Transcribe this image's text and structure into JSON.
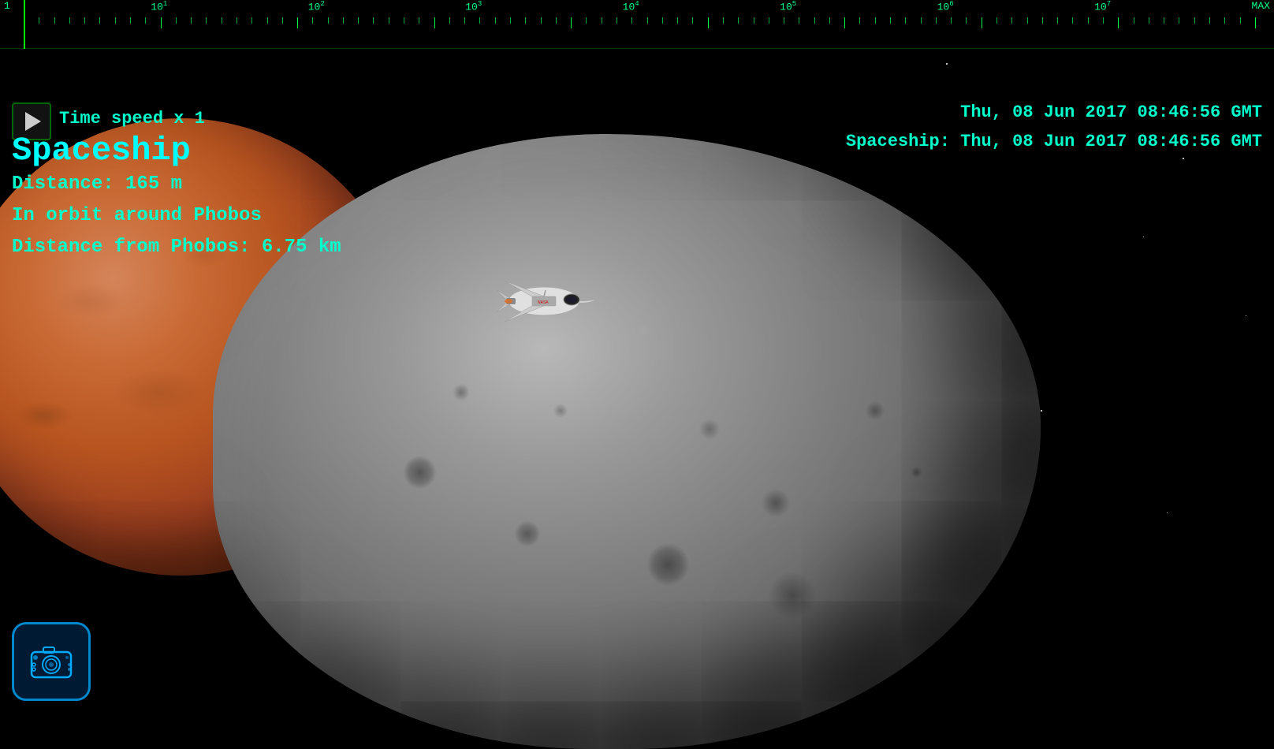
{
  "ruler": {
    "labels": [
      "1",
      "10¹",
      "10²",
      "10³",
      "10⁴",
      "10⁵",
      "10⁶",
      "10⁷",
      "MAX"
    ],
    "label_1": "1",
    "label_10_1": "10¹",
    "label_10_2": "10²",
    "label_10_3": "10³",
    "label_10_4": "10⁴",
    "label_10_5": "10⁵",
    "label_10_6": "10⁶",
    "label_10_7": "10⁷",
    "label_max": "MAX"
  },
  "controls": {
    "time_speed_label": "Time speed x 1",
    "play_button_label": "Play"
  },
  "datetime": {
    "current": "Thu,  08 Jun 2017  08:46:56 GMT",
    "spaceship_prefix": "Spaceship:",
    "spaceship_time": "Thu,  08 Jun 2017  08:46:56 GMT"
  },
  "object": {
    "name": "Spaceship",
    "distance_label": "Distance:",
    "distance_value": "165 m",
    "orbit_label": "In orbit around Phobos",
    "phobos_distance_label": "Distance from Phobos:",
    "phobos_distance_value": "6.75 km"
  },
  "camera": {
    "button_label": "Camera"
  },
  "colors": {
    "hud_cyan": "#00ffcc",
    "hud_bright_cyan": "#00ffff",
    "ruler_green": "#00ff00",
    "accent_blue": "#0088cc"
  }
}
